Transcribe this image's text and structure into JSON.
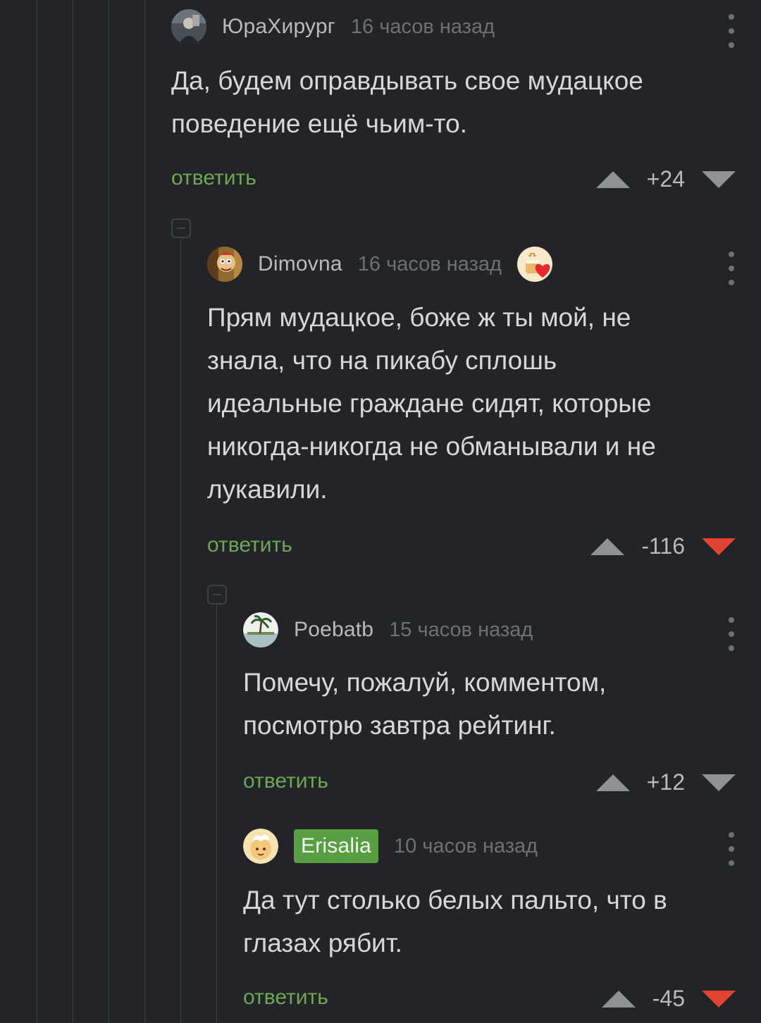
{
  "comments": [
    {
      "username": "ЮраХирург",
      "time": "16 часов назад",
      "text": "Да, будем оправдывать свое мудацкое\nповедение ещё чьим-то.",
      "reply_label": "ответить",
      "score": "+24",
      "downvoted": false
    },
    {
      "username": "Dimovna",
      "time": "16 часов назад",
      "text": "Прям мудацкое, боже ж ты мой, не\nзнала, что на пикабу сплошь\nидеальные граждане сидят, которые\nникогда-никогда не обманывали и не\nлукавили.",
      "reply_label": "ответить",
      "score": "-116",
      "downvoted": true,
      "award_icon": "heart-cake-award-icon"
    },
    {
      "username": "Poebatb",
      "time": "15 часов назад",
      "text": "Помечу, пожалуй, комментом,\nпосмотрю завтра рейтинг.",
      "reply_label": "ответить",
      "score": "+12",
      "downvoted": false
    },
    {
      "username": "Erisalia",
      "time": "10 часов назад",
      "text": "Да тут столько белых пальто, что в\nглазах рябит.",
      "reply_label": "ответить",
      "score": "-45",
      "downvoted": true,
      "username_badge_color": "#5a9e44"
    }
  ],
  "colors": {
    "background": "#222427",
    "reply": "#6fa756",
    "downvote_active": "#e3442f",
    "muted": "#6d7075"
  }
}
